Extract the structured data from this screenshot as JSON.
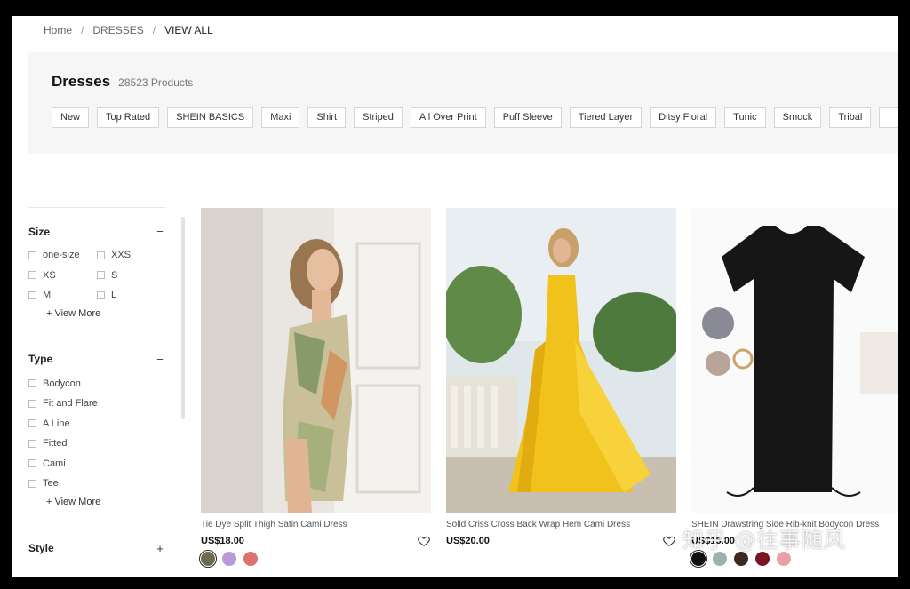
{
  "breadcrumb": {
    "home": "Home",
    "sep": "/",
    "category": "DRESSES",
    "current": "VIEW ALL"
  },
  "header": {
    "title": "Dresses",
    "count": "28523 Products"
  },
  "chips": [
    "New",
    "Top Rated",
    "SHEIN BASICS",
    "Maxi",
    "Shirt",
    "Striped",
    "All Over Print",
    "Puff Sleeve",
    "Tiered Layer",
    "Ditsy Floral",
    "Tunic",
    "Smock",
    "Tribal"
  ],
  "filters": {
    "size": {
      "label": "Size",
      "toggle": "−",
      "options": [
        "one-size",
        "XXS",
        "XS",
        "S",
        "M",
        "L"
      ],
      "more": "+ View More"
    },
    "type": {
      "label": "Type",
      "toggle": "−",
      "options": [
        "Bodycon",
        "Fit and Flare",
        "A Line",
        "Fitted",
        "Cami",
        "Tee"
      ],
      "more": "+ View More"
    },
    "style": {
      "label": "Style",
      "toggle": "+"
    }
  },
  "products": [
    {
      "name": "Tie Dye Split Thigh Satin Cami Dress",
      "price": "US$18.00",
      "swatches": [
        "#6f6a4e",
        "#b79ad6",
        "#e0706f"
      ]
    },
    {
      "name": "Solid Criss Cross Back Wrap Hem Cami Dress",
      "price": "US$20.00",
      "swatches": []
    },
    {
      "name": "SHEIN Drawstring Side Rib-knit Bodycon Dress",
      "price": "US$15.00",
      "swatches": [
        "#111111",
        "#9fb0b0",
        "#3b2a20",
        "#7b1422",
        "#e6a0a6"
      ]
    }
  ],
  "watermark": "知乎 @往事随风"
}
